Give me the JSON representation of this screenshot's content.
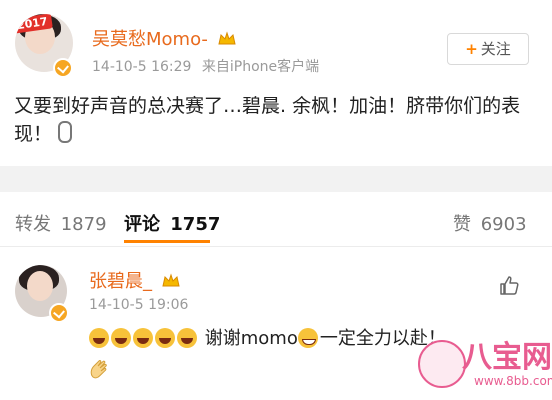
{
  "post": {
    "avatar_badge": "2017",
    "author": "吴莫愁Momo-",
    "timestamp": "14-10-5 16:29",
    "source": "来自iPhone客户端",
    "follow_label": "关注",
    "text": "又要到好声音的总决赛了…碧晨. 余枫！加油！脐带你们的表现！"
  },
  "tabs": {
    "repost": {
      "label": "转发",
      "count": "1879"
    },
    "comment": {
      "label": "评论",
      "count": "1757"
    },
    "like": {
      "label": "赞",
      "count": "6903"
    }
  },
  "comment": {
    "author": "张碧晨_",
    "timestamp": "14-10-5 19:06",
    "text_mid": "谢谢momo",
    "text_end": "一定全力以赴！"
  },
  "watermark": {
    "brand": "八宝网",
    "url": "www.8bb.com"
  },
  "colors": {
    "name": "#e86a1d",
    "accent": "#ff8200",
    "meta": "#9a9a9a",
    "separator": "#f2f2f2",
    "watermark": "#e85c90"
  },
  "icons": [
    "crown-icon",
    "verified-icon",
    "plus-icon",
    "mic-icon",
    "like-icon",
    "emoji-laugh-icon",
    "emoji-grin-icon",
    "clap-icon"
  ]
}
